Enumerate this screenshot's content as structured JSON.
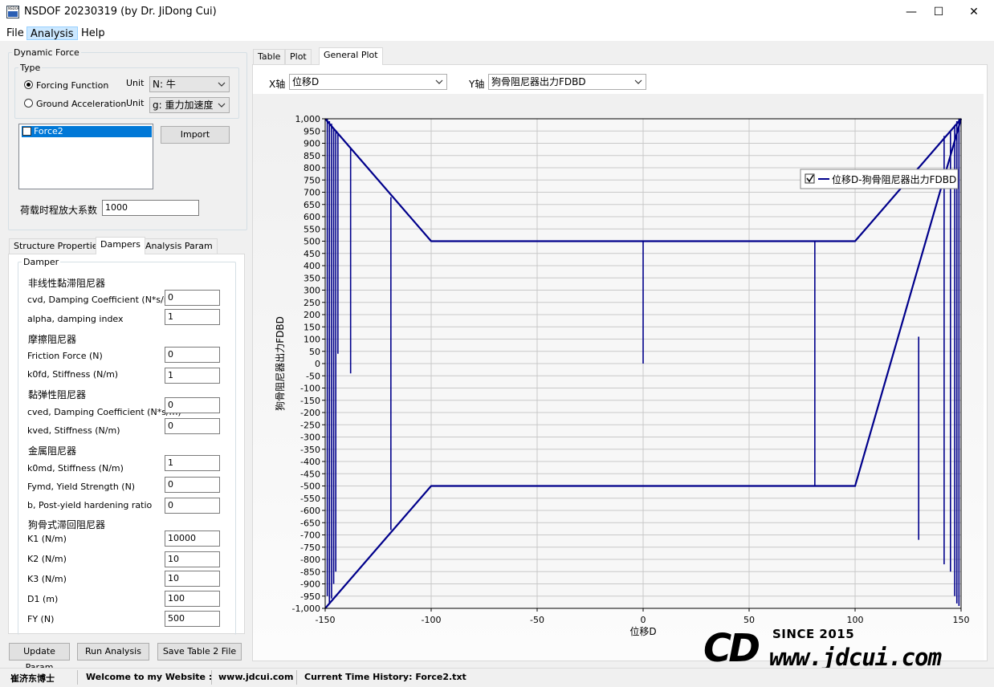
{
  "window": {
    "title": "NSDOF 20230319 (by Dr. JiDong Cui)",
    "icon_text": "NSDOF",
    "minimize": "—",
    "maximize": "☐",
    "close": "✕"
  },
  "menu": [
    "File",
    "Analysis",
    "Help"
  ],
  "dynamic_force": {
    "group": "Dynamic Force",
    "type_group": "Type",
    "forcing": {
      "label": "Forcing Function",
      "checked": true,
      "unit_label": "Unit",
      "unit_value": "N: 牛"
    },
    "ground": {
      "label": "Ground Acceleration",
      "checked": false,
      "unit_label": "Unit",
      "unit_value": "g: 重力加速度"
    },
    "list_item": "Force2",
    "import_button": "Import",
    "amplify_label": "荷载时程放大系数",
    "amplify_value": "1000"
  },
  "left_tabs": [
    "Structure Properties",
    "Dampers",
    "Analysis Param"
  ],
  "damper": {
    "group": "Damper",
    "sections": {
      "nonlinear": "非线性黏滞阻尼器",
      "friction": "摩擦阻尼器",
      "viscoelastic": "黏弹性阻尼器",
      "metal": "金属阻尼器",
      "dogbone": "狗骨式滞回阻尼器"
    },
    "fields": {
      "cvd": {
        "label": "cvd, Damping Coefficient (N*s/m)",
        "value": "0"
      },
      "alpha": {
        "label": "alpha, damping index",
        "value": "1"
      },
      "friction_force": {
        "label": "Friction Force (N)",
        "value": "0"
      },
      "k0fd": {
        "label": "k0fd, Stiffness (N/m)",
        "value": "1"
      },
      "cved": {
        "label": "cved, Damping Coefficient (N*s/m)",
        "value": "0"
      },
      "kved": {
        "label": "kved, Stiffness (N/m)",
        "value": "0"
      },
      "k0md": {
        "label": "k0md, Stiffness (N/m)",
        "value": "1"
      },
      "fymd": {
        "label": "Fymd, Yield Strength (N)",
        "value": "0"
      },
      "b": {
        "label": "b, Post-yield hardening ratio",
        "value": "0"
      },
      "k1": {
        "label": "K1  (N/m)",
        "value": "10000"
      },
      "k2": {
        "label": "K2  (N/m)",
        "value": "10"
      },
      "k3": {
        "label": "K3  (N/m)",
        "value": "10"
      },
      "d1": {
        "label": "D1  (m)",
        "value": "100"
      },
      "fy": {
        "label": "FY  (N)",
        "value": "500"
      }
    }
  },
  "bottom_buttons": [
    "Update Param",
    "Run Analysis",
    "Save Table 2 File"
  ],
  "right_tabs": [
    "Table",
    "Plot",
    "General Plot"
  ],
  "axis_selectors": {
    "x_label": "X轴",
    "x_value": "位移D",
    "y_label": "Y轴",
    "y_value": "狗骨阻尼器出力FDBD"
  },
  "watermark": {
    "logo": "CD",
    "since": "SINCE 2015",
    "url": "www.jdcui.com"
  },
  "status": [
    "崔济东博士",
    "Welcome to my Website :",
    "www.jdcui.com",
    "Current Time History: Force2.txt"
  ],
  "colors": {
    "series": "#00008b",
    "accent": "#cce8ff"
  },
  "chart_data": {
    "type": "line",
    "xlabel": "位移D",
    "ylabel": "狗骨阻尼器出力FDBD",
    "xlim": [
      -150,
      150
    ],
    "ylim": [
      -1000,
      1000
    ],
    "xticks": [
      -150,
      -100,
      -50,
      0,
      50,
      100,
      150
    ],
    "yticks": [
      1000,
      950,
      900,
      850,
      800,
      750,
      700,
      650,
      600,
      550,
      500,
      450,
      400,
      350,
      300,
      250,
      200,
      150,
      100,
      50,
      0,
      -50,
      -100,
      -150,
      -200,
      -250,
      -300,
      -350,
      -400,
      -450,
      -500,
      -550,
      -600,
      -650,
      -700,
      -750,
      -800,
      -850,
      -900,
      -950,
      -1000
    ],
    "ytick_labels": [
      "1,000",
      "950",
      "900",
      "850",
      "800",
      "750",
      "700",
      "650",
      "600",
      "550",
      "500",
      "450",
      "400",
      "350",
      "300",
      "250",
      "200",
      "150",
      "100",
      "50",
      "0",
      "-50",
      "-100",
      "-150",
      "-200",
      "-250",
      "-300",
      "-350",
      "-400",
      "-450",
      "-500",
      "-550",
      "-600",
      "-650",
      "-700",
      "-750",
      "-800",
      "-850",
      "-900",
      "-950",
      "-1,000"
    ],
    "grid": true,
    "legend_position": "top-right",
    "series": [
      {
        "name": "位移D-狗骨阻尼器出力FDBD",
        "x": [
          -150,
          -100,
          100,
          150,
          100,
          -100,
          -150
        ],
        "y": [
          1000,
          500,
          500,
          1000,
          -500,
          -500,
          -1000
        ]
      }
    ],
    "verticals": [
      {
        "x": -149,
        "y": [
          -950,
          1000
        ]
      },
      {
        "x": -148,
        "y": [
          -980,
          990
        ]
      },
      {
        "x": -147,
        "y": [
          -960,
          980
        ]
      },
      {
        "x": -146,
        "y": [
          -900,
          960
        ]
      },
      {
        "x": -145,
        "y": [
          -850,
          950
        ]
      },
      {
        "x": -144,
        "y": [
          40,
          940
        ]
      },
      {
        "x": -138,
        "y": [
          -40,
          880
        ]
      },
      {
        "x": -119,
        "y": [
          -680,
          680
        ]
      },
      {
        "x": 0,
        "y": [
          0,
          500
        ]
      },
      {
        "x": 81,
        "y": [
          -500,
          500
        ]
      },
      {
        "x": 130,
        "y": [
          -720,
          110
        ]
      },
      {
        "x": 142,
        "y": [
          -820,
          930
        ]
      },
      {
        "x": 145,
        "y": [
          -850,
          950
        ]
      },
      {
        "x": 147,
        "y": [
          -950,
          975
        ]
      },
      {
        "x": 148,
        "y": [
          -980,
          990
        ]
      },
      {
        "x": 149,
        "y": [
          -990,
          1000
        ]
      }
    ]
  }
}
